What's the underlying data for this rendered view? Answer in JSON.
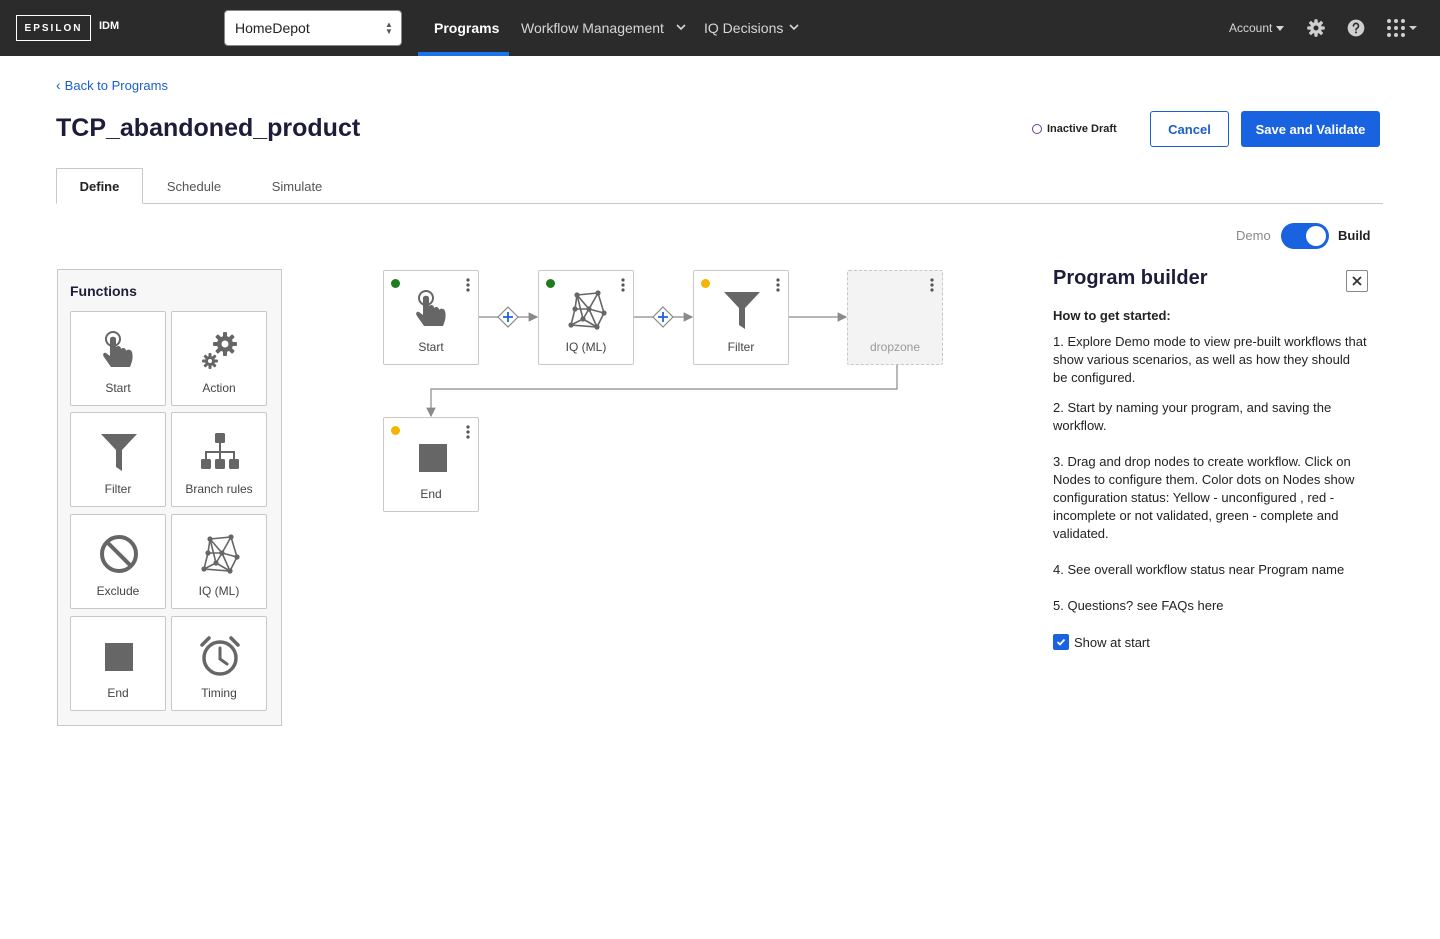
{
  "nav": {
    "logo": "EPSILON",
    "logo_sub": "IDM",
    "client": "HomeDepot",
    "items": [
      {
        "label": "Programs"
      },
      {
        "label": "Workflow Management"
      },
      {
        "label": "IQ Decisions"
      }
    ],
    "account": "Account",
    "icons": [
      "gear-icon",
      "help-icon",
      "apps-grid-icon"
    ]
  },
  "header": {
    "back": "Back to Programs",
    "title": "TCP_abandoned_product",
    "status": "Inactive Draft",
    "cancel": "Cancel",
    "save": "Save and Validate",
    "status_color": "#6b3fa0",
    "accent": "#1a63e0"
  },
  "tabs": [
    {
      "label": "Define"
    },
    {
      "label": "Schedule"
    },
    {
      "label": "Simulate"
    }
  ],
  "mode_toggle": {
    "left": "Demo",
    "right": "Build",
    "selected": "Build"
  },
  "functions": {
    "title": "Functions",
    "items": [
      {
        "label": "Start",
        "icon": "hand-pointer-icon"
      },
      {
        "label": "Action",
        "icon": "gears-icon"
      },
      {
        "label": "Filter",
        "icon": "funnel-icon"
      },
      {
        "label": "Branch rules",
        "icon": "hierarchy-icon"
      },
      {
        "label": "Exclude",
        "icon": "ban-icon"
      },
      {
        "label": "IQ (ML)",
        "icon": "network-icon"
      },
      {
        "label": "End",
        "icon": "stop-square-icon"
      },
      {
        "label": "Timing",
        "icon": "alarm-clock-icon"
      }
    ]
  },
  "workflow": {
    "nodes": [
      {
        "label": "Start",
        "status": "complete",
        "dot_color": "#1e7b1e"
      },
      {
        "label": "IQ (ML)",
        "status": "complete",
        "dot_color": "#1e7b1e"
      },
      {
        "label": "Filter",
        "status": "unconfigured",
        "dot_color": "#f4b400"
      },
      {
        "label": "dropzone",
        "status": "empty"
      },
      {
        "label": "End",
        "status": "unconfigured",
        "dot_color": "#f4b400"
      }
    ]
  },
  "builder": {
    "title": "Program builder",
    "subtitle": "How to get started:",
    "steps": [
      "1. Explore Demo mode to view pre-built workflows that show various scenarios, as well as how they should be configured.",
      "2. Start by naming your program, and saving the workflow.",
      "3. Drag and drop nodes to create workflow. Click on Nodes to configure them. Color dots on Nodes show configuration status: Yellow - unconfigured , red - incomplete or not validated, green - complete and validated.",
      "4. See overall workflow status near Program name",
      "5. Questions? see FAQs here"
    ],
    "show_at_start": "Show at start",
    "show_at_start_checked": true
  }
}
